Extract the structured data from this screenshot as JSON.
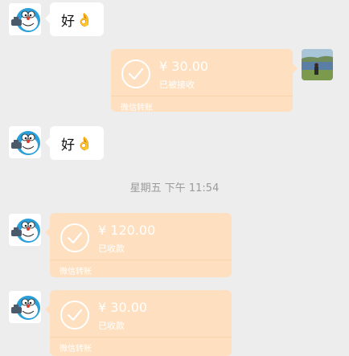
{
  "messages": [
    {
      "text": "好",
      "emoji": "👌"
    },
    {
      "amount": "¥ 30.00",
      "status": "已被接收",
      "footer": "微信转账"
    },
    {
      "text": "好",
      "emoji": "👌"
    },
    {
      "amount": "¥ 120.00",
      "status": "已收款",
      "footer": "微信转账"
    },
    {
      "amount": "¥ 30.00",
      "status": "已收款",
      "footer": "微信转账"
    }
  ],
  "timestamp": "星期五 下午 11:54",
  "colors": {
    "background": "#ededed",
    "transfer_bubble": "#fee0c0",
    "text_bubble": "#ffffff",
    "avatar_blue": "#2a9fd8"
  }
}
